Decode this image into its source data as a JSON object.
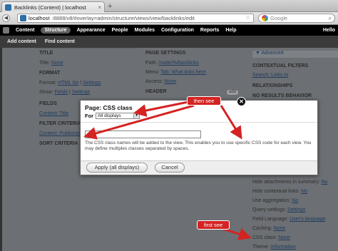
{
  "browser": {
    "tab_title": "Backlinks (Content) | localhost",
    "tab_close": "×",
    "new_tab": "+",
    "url_host": "localhost",
    "url_rest": ":8888/v8/#overlay=admin/structure/views/view/backlinks/edit",
    "search_placeholder": "Google"
  },
  "toolbar": {
    "items": [
      "Content",
      "Structure",
      "Appearance",
      "People",
      "Modules",
      "Configuration",
      "Reports",
      "Help"
    ],
    "hello": "Hello"
  },
  "shortcuts": [
    "Add content",
    "Find content"
  ],
  "page": {
    "title_label": "TITLE",
    "title_value_prefix": "Title:",
    "title_value": "None",
    "format_label": "FORMAT",
    "format_prefix": "Format:",
    "format_value": "HTML list",
    "format_settings": "Settings",
    "show_prefix": "Show:",
    "show_value": "Fields",
    "show_settings": "Settings",
    "fields_label": "FIELDS",
    "fields_value": "Content: Title",
    "filter_label": "FILTER CRITERIA",
    "filter_value": "Content: Published",
    "sort_label": "SORT CRITERIA",
    "page_settings_label": "PAGE SETTINGS",
    "path_prefix": "Path:",
    "path_value": "/node/%/backlinks",
    "menu_prefix": "Menu:",
    "menu_value": "Tab: What links here",
    "access_prefix": "Access:",
    "access_value": "None",
    "header_label": "HEADER",
    "add_label": "add",
    "advanced_label": "▼ Advanced",
    "contextual_label": "CONTEXTUAL FILTERS",
    "contextual_value": "Search: Links to",
    "relationships_label": "RELATIONSHIPS",
    "no_results_label": "NO RESULTS BEHAVIOR",
    "right_rows": [
      {
        "label": "Hide attachments in summary:",
        "value": "No"
      },
      {
        "label": "Hide contextual links:",
        "value": "No"
      },
      {
        "label": "Use aggregation:",
        "value": "No"
      },
      {
        "label": "Query settings:",
        "value": "Settings"
      },
      {
        "label": "Field Language:",
        "value": "User's language"
      },
      {
        "label": "Caching:",
        "value": "None"
      },
      {
        "label": "CSS class:",
        "value": "None"
      },
      {
        "label": "Theme:",
        "value": "Information"
      }
    ]
  },
  "modal": {
    "title": "Page: CSS class",
    "close": "✕",
    "for_label": "For",
    "display_select": "All displays",
    "input_value": "",
    "description": "The CSS class names will be added to the view. This enables you to use specific CSS code for each view. You may define multiples classes separated by spaces.",
    "apply_button": "Apply (all displays)",
    "cancel_button": "Cancel"
  },
  "callouts": {
    "then_see": "then see",
    "first_see": "first see"
  },
  "colors": {
    "callout_red": "#d42323",
    "toolbar_black": "#000000",
    "link_blue": "#1f3c61"
  }
}
